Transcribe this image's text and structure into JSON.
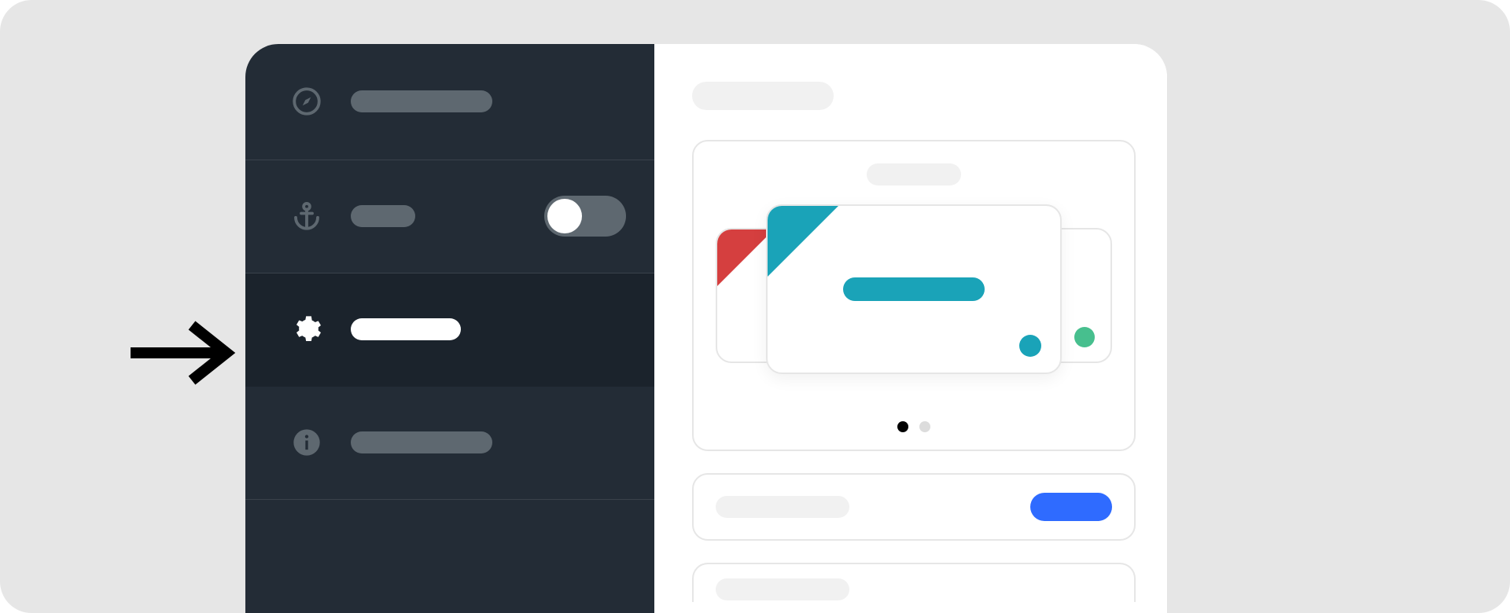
{
  "pointer": {
    "icon": "arrow-right"
  },
  "sidebar": {
    "items": [
      {
        "id": "explore",
        "icon": "compass-icon",
        "active": false,
        "toggle": false
      },
      {
        "id": "anchor",
        "icon": "anchor-icon",
        "active": false,
        "toggle": true,
        "toggle_on": false
      },
      {
        "id": "settings",
        "icon": "gear-icon",
        "active": true,
        "toggle": false
      },
      {
        "id": "info",
        "icon": "info-icon",
        "active": false,
        "toggle": false
      }
    ]
  },
  "main": {
    "carousel": {
      "cards": [
        {
          "id": "left",
          "accent": "#d53f3f",
          "corner": true,
          "dot": false
        },
        {
          "id": "center",
          "accent": "#1aa3b8",
          "corner": true,
          "dot": true
        },
        {
          "id": "right",
          "accent": "#47bf8e",
          "corner": false,
          "dot": true
        }
      ],
      "active_index": 1,
      "page_count": 2,
      "active_page": 0
    },
    "rows": [
      {
        "action_color": "#2f6bff"
      }
    ]
  }
}
